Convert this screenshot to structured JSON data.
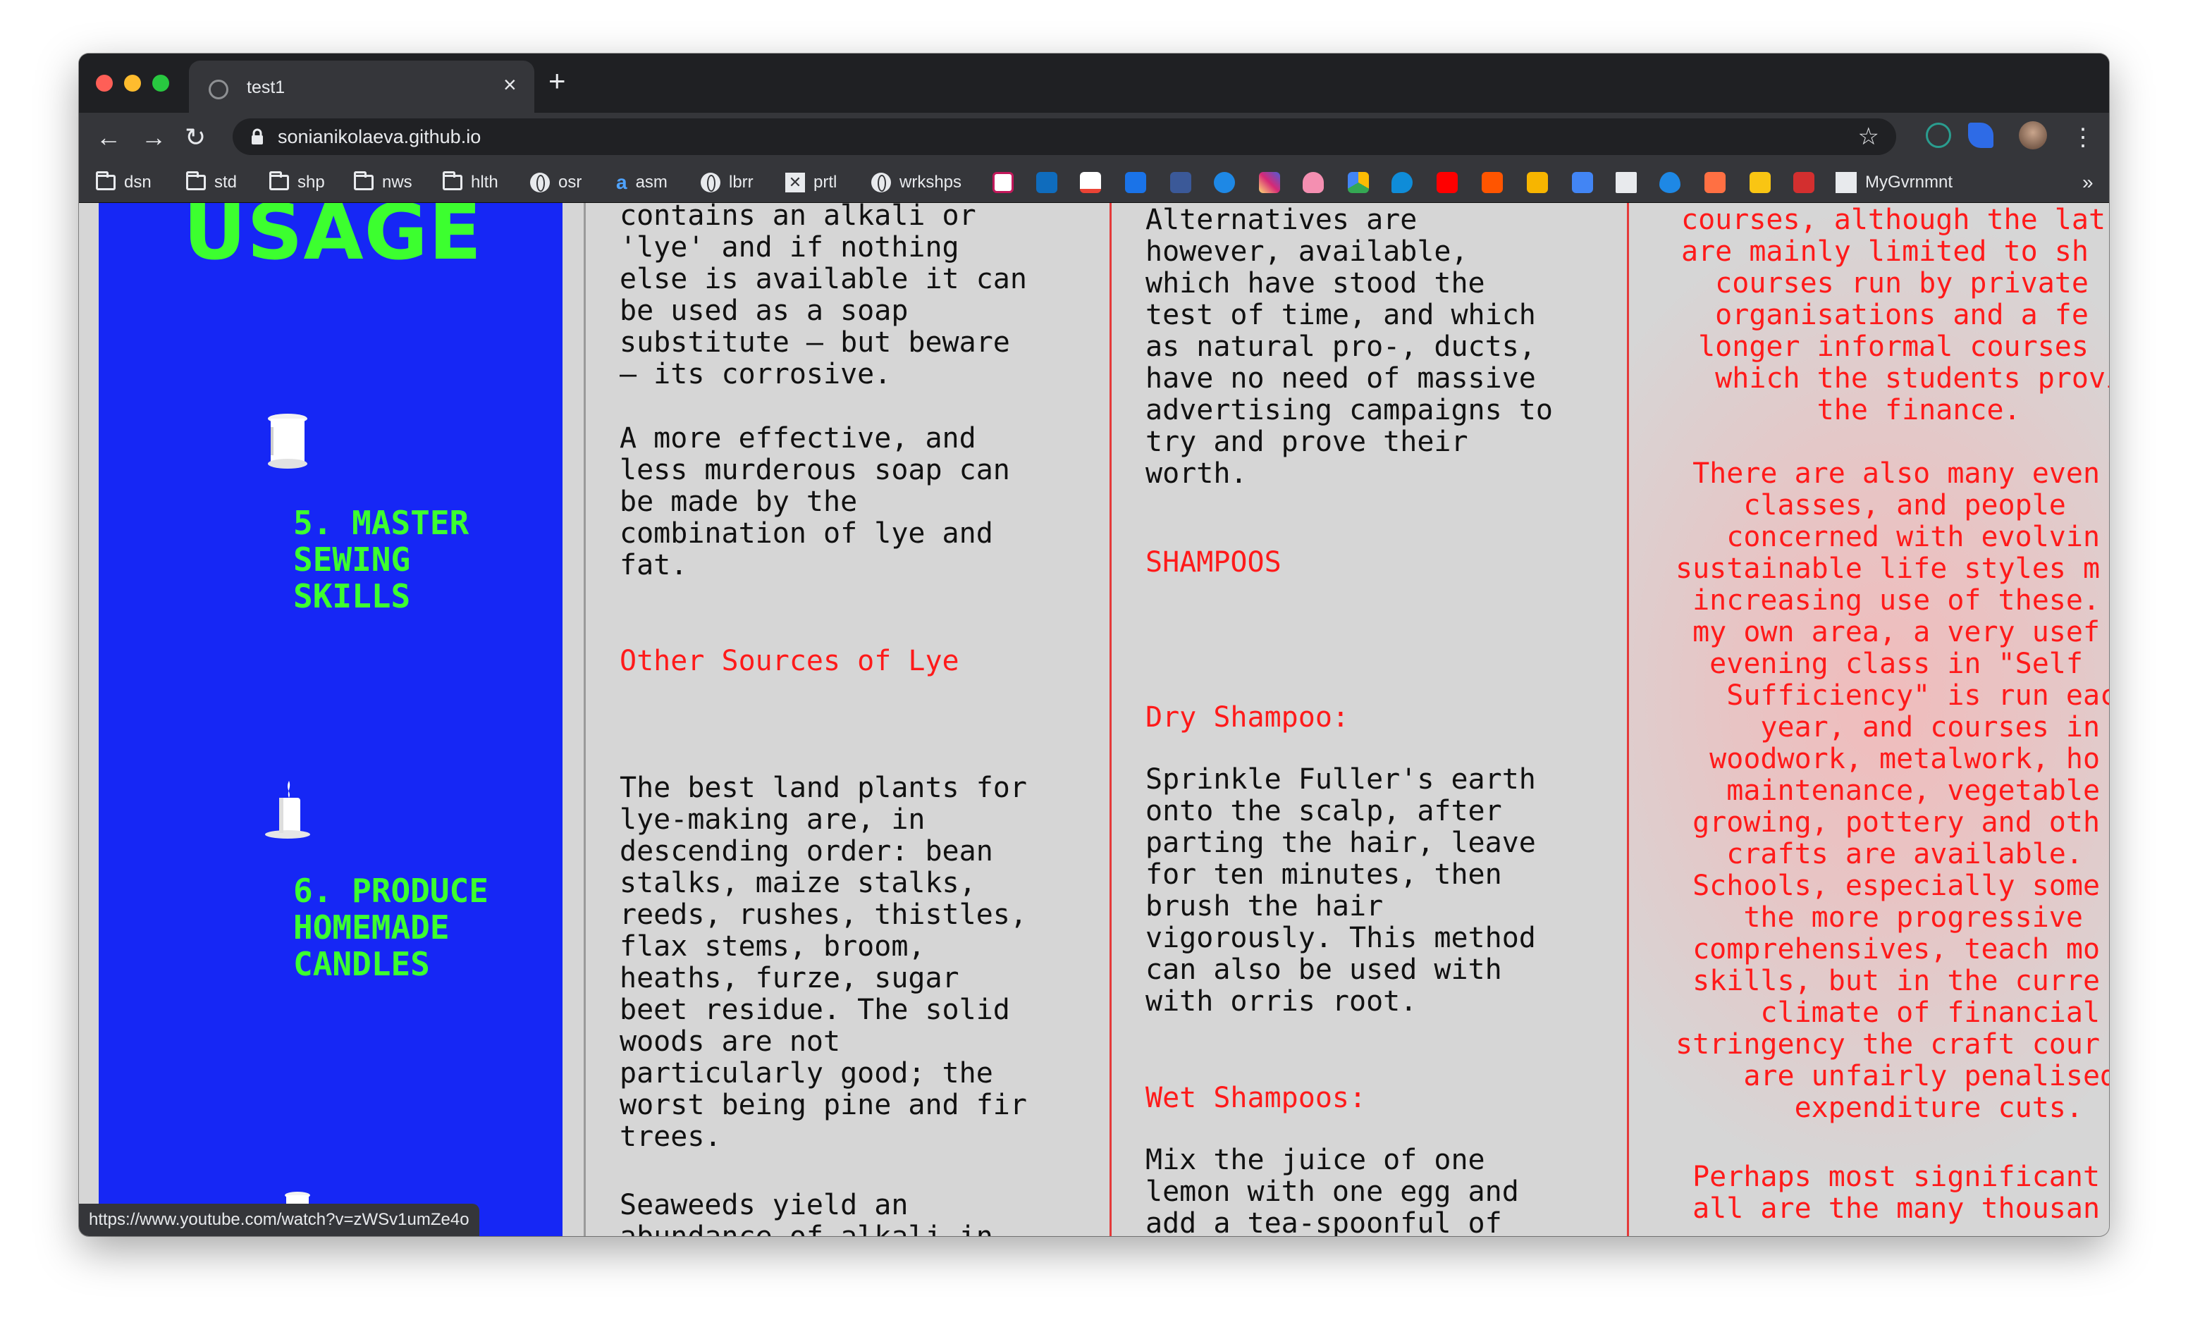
{
  "browser": {
    "tab_title": "test1",
    "url": "sonianikolaeva.github.io",
    "status_url": "https://www.youtube.com/watch?v=zWSv1umZe4o",
    "bookmarks": [
      "dsn",
      "std",
      "shp",
      "nws",
      "hlth",
      "osr",
      "asm",
      "lbrr",
      "prtl",
      "wrkshps",
      "MyGvrnmnt"
    ],
    "bookmark_icons": [
      "draw-icon",
      "outlook-icon",
      "gmail-icon",
      "mail-icon",
      "facebook-icon",
      "messenger-icon",
      "instagram-icon",
      "cloud-icon",
      "drive-icon",
      "edge-icon",
      "youtube-icon",
      "soundcloud-icon",
      "stack-icon",
      "translate-icon",
      "docs-icon",
      "drop-icon",
      "calendar-icon",
      "trello-icon",
      "dn-icon"
    ]
  },
  "sidebar": {
    "heading": "USAGE",
    "items": [
      {
        "label": "5. MASTER\nSEWING\nSKILLS",
        "icon": "thread-spool-icon"
      },
      {
        "label": "6. PRODUCE\nHOMEMADE\nCANDLES",
        "icon": "candle-icon"
      },
      {
        "icon": "spool-icon"
      }
    ]
  },
  "col2": {
    "p1": "contains an alkali or\n'lye' and if nothing\nelse is available it can\nbe used as a soap\nsubstitute — but beware\n— its corrosive.",
    "p2": "A more effective, and\nless murderous soap can\nbe made by the\ncombination of lye and\nfat.",
    "heading": "Other Sources of Lye",
    "p3": "The best land plants for\nlye-making are, in\ndescending order: bean\nstalks, maize stalks,\nreeds, rushes, thistles,\nflax stems, broom,\nheaths, furze, sugar\nbeet residue. The solid\nwoods are not\nparticularly good; the\nworst being pine and fir\ntrees.",
    "p4": "Seaweeds yield an\nabundance of alkali in"
  },
  "col3": {
    "p1": "Alternatives are\nhowever, available,\nwhich have stood the\ntest of time, and which\nas natural pro-, ducts,\nhave no need of massive\nadvertising campaigns to\ntry and prove their\nworth.",
    "heading": "SHAMPOOS",
    "sub1": "Dry Shampoo:",
    "p2": "Sprinkle Fuller's earth\nonto the scalp, after\nparting the hair, leave\nfor ten minutes, then\nbrush the hair\nvigorously. This method\ncan also be used with\nwith orris root.",
    "sub2": "Wet Shampoos:",
    "p3": "Mix the juice of one\nlemon with one egg and\nadd a tea-spoonful of"
  },
  "col4": {
    "p1": "courses, although the lat\nare mainly limited to sh\n  courses run by private\n  organisations and a fe\n longer informal courses\n  which the students provi\n        the finance.",
    "p2": " There are also many even\n    classes, and people\n   concerned with evolvin\nsustainable life styles m\n increasing use of these.\n my own area, a very usef\n  evening class in \"Self\n   Sufficiency\" is run eac\n     year, and courses in\n  woodwork, metalwork, ho\n   maintenance, vegetable\n growing, pottery and oth\n   crafts are available.\n Schools, especially some\n    the more progressive\n comprehensives, teach mo\n skills, but in the curre\n     climate of financial\nstringency the craft cour\n    are unfairly penalised\n       expenditure cuts.",
    "p3": " Perhaps most significant\n all are the many thousan"
  },
  "colors": {
    "sidebar_bg": "#1627f5",
    "accent_green": "#3cff2f",
    "accent_red": "#ff1a1a",
    "page_bg": "#d6d6d6"
  }
}
